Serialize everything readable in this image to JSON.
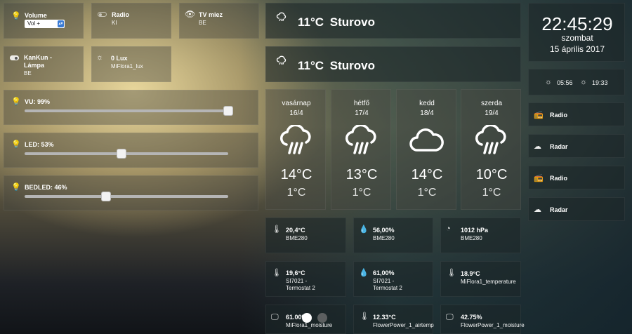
{
  "left": {
    "volume": {
      "label": "Volume",
      "select_value": "Vol +"
    },
    "radio": {
      "label": "Radio",
      "value": "KI"
    },
    "tv": {
      "label": "TV miez",
      "value": "BE"
    },
    "kankun": {
      "label_line1": "KanKun -",
      "label_line2": "Lámpa",
      "value": "BE"
    },
    "lux": {
      "label": "0 Lux",
      "value": "MiFlora1_lux"
    },
    "sliders": [
      {
        "label": "VU: 99%",
        "level_pct": 99
      },
      {
        "label": "LED: 53%",
        "level_pct": 53
      },
      {
        "label": "BEDLED: 46%",
        "level_pct": 46
      }
    ]
  },
  "weather": {
    "title1": "11°C  Sturovo",
    "title2": "11°C  Sturovo",
    "days": [
      {
        "name": "vasárnap",
        "date": "16/4",
        "icon": "cloud-rain-icon",
        "high": "14°C",
        "low": "1°C"
      },
      {
        "name": "hétfő",
        "date": "17/4",
        "icon": "cloud-rain-icon",
        "high": "13°C",
        "low": "1°C"
      },
      {
        "name": "kedd",
        "date": "18/4",
        "icon": "cloud-icon",
        "high": "14°C",
        "low": "1°C"
      },
      {
        "name": "szerda",
        "date": "19/4",
        "icon": "cloud-rain-icon",
        "high": "10°C",
        "low": "1°C"
      }
    ]
  },
  "sensors": [
    {
      "icon": "thermometer-icon",
      "value": "20,4°C",
      "name1": "BME280",
      "name2": ""
    },
    {
      "icon": "droplet-icon",
      "value": "56,00%",
      "name1": "BME280",
      "name2": ""
    },
    {
      "icon": "gauge-icon",
      "value": "1012 hPa",
      "name1": "BME280",
      "name2": ""
    },
    {
      "icon": "thermometer-icon",
      "value": "19,6°C",
      "name1": "SI7021 -",
      "name2": "Termostat 2"
    },
    {
      "icon": "droplet-icon",
      "value": "61,00%",
      "name1": "SI7021 -",
      "name2": "Termostat 2"
    },
    {
      "icon": "thermometer-icon",
      "value": "18.9°C",
      "name1": "MiFlora1_temperature",
      "name2": ""
    },
    {
      "icon": "monitor-icon",
      "value": "61.00%",
      "name1": "MiFlora1_moisture",
      "name2": ""
    },
    {
      "icon": "thermometer-icon",
      "value": "12.33°C",
      "name1": "FlowerPower_1_airtemp",
      "name2": ""
    },
    {
      "icon": "monitor-icon",
      "value": "42.75%",
      "name1": "FlowerPower_1_moisture",
      "name2": ""
    }
  ],
  "clock": {
    "time": "22:45:29",
    "weekday": "szombat",
    "date": "15 április 2017"
  },
  "sun": {
    "sunrise": "05:56",
    "sunset": "19:33"
  },
  "side_buttons": [
    {
      "icon": "radio-icon",
      "label": "Radio"
    },
    {
      "icon": "cloud-icon",
      "label": "Radar"
    },
    {
      "icon": "radio-icon",
      "label": "Radio"
    },
    {
      "icon": "cloud-icon",
      "label": "Radar"
    }
  ]
}
